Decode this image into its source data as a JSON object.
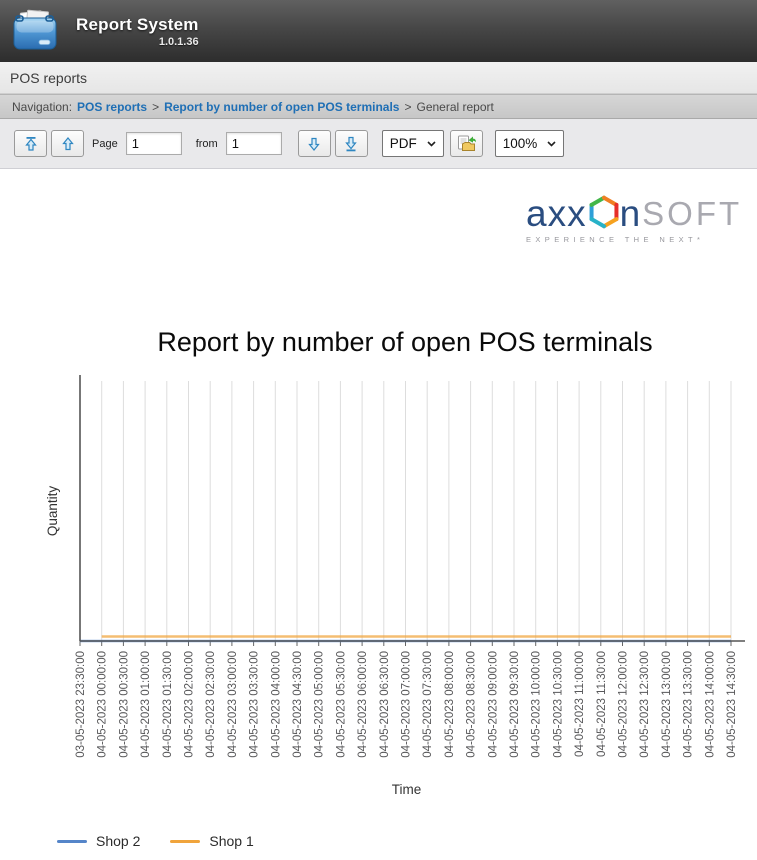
{
  "header": {
    "title": "Report System",
    "version": "1.0.1.36"
  },
  "tab_bar": {
    "label": "POS reports"
  },
  "breadcrumb": {
    "prefix": "Navigation:",
    "separator": ">",
    "items": [
      {
        "label": "POS reports",
        "is_link": true
      },
      {
        "label": "Report by number of open POS terminals",
        "is_link": true
      },
      {
        "label": "General report",
        "is_link": false
      }
    ]
  },
  "toolbar": {
    "page_label": "Page",
    "page_value": "1",
    "from_label": "from",
    "page_count": "1",
    "format_value": "PDF",
    "zoom_value": "100%",
    "icons": [
      "first-page-arrow-up-bar",
      "previous-page-arrow-up",
      "next-page-arrow-down",
      "last-page-arrow-down-bar",
      "export-report",
      "chevron-down"
    ]
  },
  "logo": {
    "part_axx": "axx",
    "part_n": "n",
    "part_soft": "SOFT",
    "tagline": "EXPERIENCE THE NEXT*"
  },
  "colors": {
    "link_blue": "#1F6FB5",
    "toolbar_arrow_blue": "#2E86C1",
    "grid_gray": "#DDDDDD",
    "axis_gray": "#555555"
  },
  "chart_data": {
    "type": "line",
    "title": "Report by number of open POS terminals",
    "xlabel": "Time",
    "ylabel": "Quantity",
    "grid": "vertical-only",
    "y_tick_labels_visible": false,
    "legend_position": "bottom-left",
    "categories": [
      "03-05-2023 23:30:00",
      "04-05-2023 00:00:00",
      "04-05-2023 00:30:00",
      "04-05-2023 01:00:00",
      "04-05-2023 01:30:00",
      "04-05-2023 02:00:00",
      "04-05-2023 02:30:00",
      "04-05-2023 03:00:00",
      "04-05-2023 03:30:00",
      "04-05-2023 04:00:00",
      "04-05-2023 04:30:00",
      "04-05-2023 05:00:00",
      "04-05-2023 05:30:00",
      "04-05-2023 06:00:00",
      "04-05-2023 06:30:00",
      "04-05-2023 07:00:00",
      "04-05-2023 07:30:00",
      "04-05-2023 08:00:00",
      "04-05-2023 08:30:00",
      "04-05-2023 09:00:00",
      "04-05-2023 09:30:00",
      "04-05-2023 10:00:00",
      "04-05-2023 10:30:00",
      "04-05-2023 11:00:00",
      "04-05-2023 11:30:00",
      "04-05-2023 12:00:00",
      "04-05-2023 12:30:00",
      "04-05-2023 13:00:00",
      "04-05-2023 13:30:00",
      "04-05-2023 14:00:00",
      "04-05-2023 14:30:00"
    ],
    "series": [
      {
        "name": "Shop 2",
        "color": "#5585C9",
        "values": [
          0,
          0,
          0,
          0,
          0,
          0,
          0,
          0,
          0,
          0,
          0,
          0,
          0,
          0,
          0,
          0,
          0,
          0,
          0,
          0,
          0,
          0,
          0,
          0,
          0,
          0,
          0,
          0,
          0,
          0,
          0
        ],
        "note": "flat at zero, coincides with x-axis (not visually distinguishable)"
      },
      {
        "name": "Shop 1",
        "color": "#F0A43C",
        "values": [
          null,
          1,
          1,
          1,
          1,
          1,
          1,
          1,
          1,
          1,
          1,
          1,
          1,
          1,
          1,
          1,
          1,
          1,
          1,
          1,
          1,
          1,
          1,
          1,
          1,
          1,
          1,
          1,
          1,
          1,
          1
        ],
        "note": "flat line slightly above axis from 00:00 to 14:30"
      }
    ]
  }
}
